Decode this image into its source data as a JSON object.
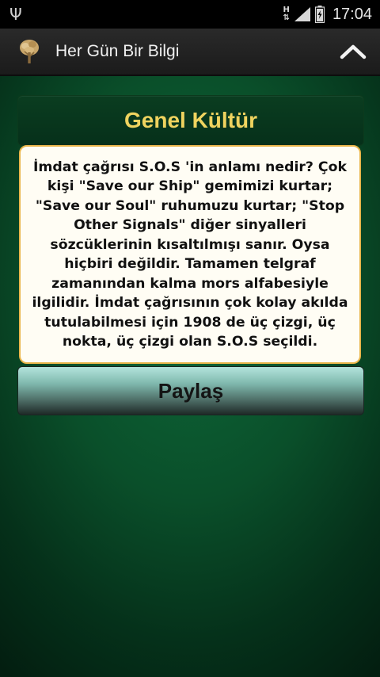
{
  "status_bar": {
    "time": "17:04",
    "network_top": "H",
    "network_bottom": "⇅",
    "icons": [
      "usb-icon",
      "network-type-icon",
      "signal-icon",
      "battery-icon"
    ]
  },
  "action_bar": {
    "title": "Her Gün Bir Bilgi",
    "icon": "tree-app-icon",
    "up_icon": "chevron-up-icon"
  },
  "card": {
    "category": "Genel Kültür",
    "text": "İmdat çağrısı S.O.S 'in anlamı nedir? Çok kişi \"Save our Ship\" gemimizi kurtar; \"Save our Soul\" ruhumuzu kurtar; \"Stop Other Signals\" diğer sinyalleri sözcüklerinin kısaltılmışı sanır. Oysa hiçbiri değildir. Tamamen telgraf zamanından kalma mors alfabesiyle ilgilidir. İmdat çağrısının çok kolay akılda tutulabilmesi için 1908 de üç çizgi, üç nokta, üç çizgi olan S.O.S seçildi."
  },
  "share_button": {
    "label": "Paylaş"
  },
  "colors": {
    "accent_title": "#efd35f",
    "box_border": "#e9b54a",
    "background_green": "#0a4f2a"
  }
}
